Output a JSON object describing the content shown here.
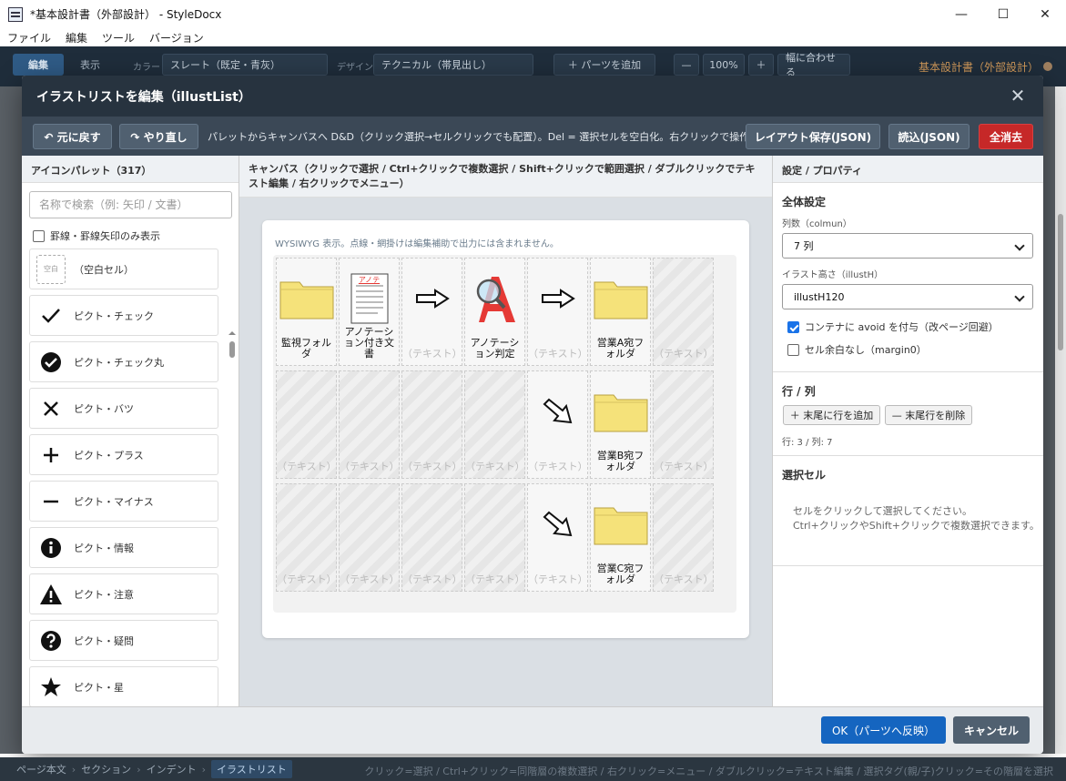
{
  "window": {
    "title": "*基本設計書（外部設計） - StyleDocx",
    "minimize": "—",
    "maximize": "☐",
    "close": "✕"
  },
  "menu": [
    "ファイル",
    "編集",
    "ツール",
    "バージョン"
  ],
  "toolbar": {
    "mode_edit": "編集",
    "mode_view": "表示",
    "color_label": "カラー",
    "color_value": "スレート（既定・青灰）",
    "design_label": "デザイン",
    "design_value": "テクニカル（帯見出し）",
    "add_parts": "＋ パーツを追加",
    "zoom_out": "—",
    "zoom": "100%",
    "zoom_in": "＋",
    "fit": "幅に合わせる",
    "doc_title": "基本設計書（外部設計）"
  },
  "dialog": {
    "title": "イラストリストを編集（illustList）",
    "close": "✕",
    "undo": "↶ 元に戻す",
    "redo": "↷ やり直し",
    "hint": "パレットからキャンバスへ D&D（クリック選択→セルクリックでも配置）。Del = 選択セルを空白化。右クリックで操作メニュー。",
    "save_layout": "レイアウト保存(JSON)",
    "load": "読込(JSON)",
    "clear_all": "全消去",
    "ok": "OK（パーツへ反映）",
    "cancel": "キャンセル"
  },
  "palette": {
    "header": "アイコンパレット（317）",
    "search_placeholder": "名称で検索（例: 矢印 / 文書）",
    "filter_label": "罫線・罫線矢印のみ表示",
    "items": [
      {
        "icon": "blank-cell-icon",
        "glyph": "空白",
        "label": "（空白セル）"
      },
      {
        "icon": "check-icon",
        "glyph": "✓",
        "label": "ピクト・チェック"
      },
      {
        "icon": "check-circle-icon",
        "glyph": "✔",
        "label": "ピクト・チェック丸"
      },
      {
        "icon": "cross-icon",
        "glyph": "✕",
        "label": "ピクト・バツ"
      },
      {
        "icon": "plus-icon",
        "glyph": "＋",
        "label": "ピクト・プラス"
      },
      {
        "icon": "minus-icon",
        "glyph": "—",
        "label": "ピクト・マイナス"
      },
      {
        "icon": "info-icon",
        "glyph": "i",
        "label": "ピクト・情報"
      },
      {
        "icon": "warning-icon",
        "glyph": "!",
        "label": "ピクト・注意"
      },
      {
        "icon": "question-icon",
        "glyph": "?",
        "label": "ピクト・疑問"
      },
      {
        "icon": "star-icon",
        "glyph": "★",
        "label": "ピクト・星"
      }
    ]
  },
  "canvas": {
    "header": "キャンバス（クリックで選択 / Ctrl+クリックで複数選択 / Shift+クリックで範囲選択 / ダブルクリックでテキスト編集 / 右クリックでメニュー）",
    "wysiwyg_note": "WYSIWYG 表示。点線・網掛けは編集補助で出力には含まれません。",
    "placeholder": "（テキスト）",
    "cells": [
      [
        {
          "icon": "folder-icon",
          "text": "監視フォルダ"
        },
        {
          "icon": "document-icon",
          "img_label": "アノテ",
          "text": "アノテーション付き文書"
        },
        {
          "icon": "arrow-right-icon",
          "text": ""
        },
        {
          "icon": "annotation-judge-icon",
          "img_label": "A",
          "text": "アノテーション判定"
        },
        {
          "icon": "arrow-right-icon",
          "text": ""
        },
        {
          "icon": "folder-icon",
          "text": "営業A宛フォルダ"
        },
        {
          "icon": "",
          "text": ""
        }
      ],
      [
        {
          "icon": "",
          "text": ""
        },
        {
          "icon": "",
          "text": ""
        },
        {
          "icon": "",
          "text": ""
        },
        {
          "icon": "",
          "text": ""
        },
        {
          "icon": "arrow-down-right-icon",
          "text": ""
        },
        {
          "icon": "folder-icon",
          "text": "営業B宛フォルダ"
        },
        {
          "icon": "",
          "text": ""
        }
      ],
      [
        {
          "icon": "",
          "text": ""
        },
        {
          "icon": "",
          "text": ""
        },
        {
          "icon": "",
          "text": ""
        },
        {
          "icon": "",
          "text": ""
        },
        {
          "icon": "arrow-down-right-icon",
          "text": ""
        },
        {
          "icon": "folder-icon",
          "text": "営業C宛フォルダ"
        },
        {
          "icon": "",
          "text": ""
        }
      ]
    ]
  },
  "props": {
    "header": "設定 / プロパティ",
    "global_title": "全体設定",
    "columns_label": "列数（colmun）",
    "columns_value": "7 列",
    "height_label": "イラスト高さ（illustH）",
    "height_value": "illustH120",
    "avoid_label": "コンテナに avoid を付与（改ページ回避）",
    "nomargin_label": "セル余白なし（margin0）",
    "rowcol_title": "行 / 列",
    "add_row": "＋ 末尾に行を追加",
    "del_row": "— 末尾行を削除",
    "rowcol_info": "行: 3 / 列: 7",
    "selected_title": "選択セル",
    "selected_hint1": "セルをクリックして選択してください。",
    "selected_hint2": "Ctrl+クリックやShift+クリックで複数選択できます。"
  },
  "statusbar": {
    "crumbs": [
      "ページ本文",
      "セクション",
      "インデント",
      "イラストリスト"
    ],
    "hint": "クリック=選択 / Ctrl+クリック=同階層の複数選択 / 右クリック=メニュー / ダブルクリック=テキスト編集 / 選択タグ(親/子)クリック=その階層を選択"
  },
  "colors": {
    "accent": "#1565c0",
    "danger": "#c62828",
    "toolbar": "#1f2d3b",
    "folder": "#f5e27a"
  }
}
